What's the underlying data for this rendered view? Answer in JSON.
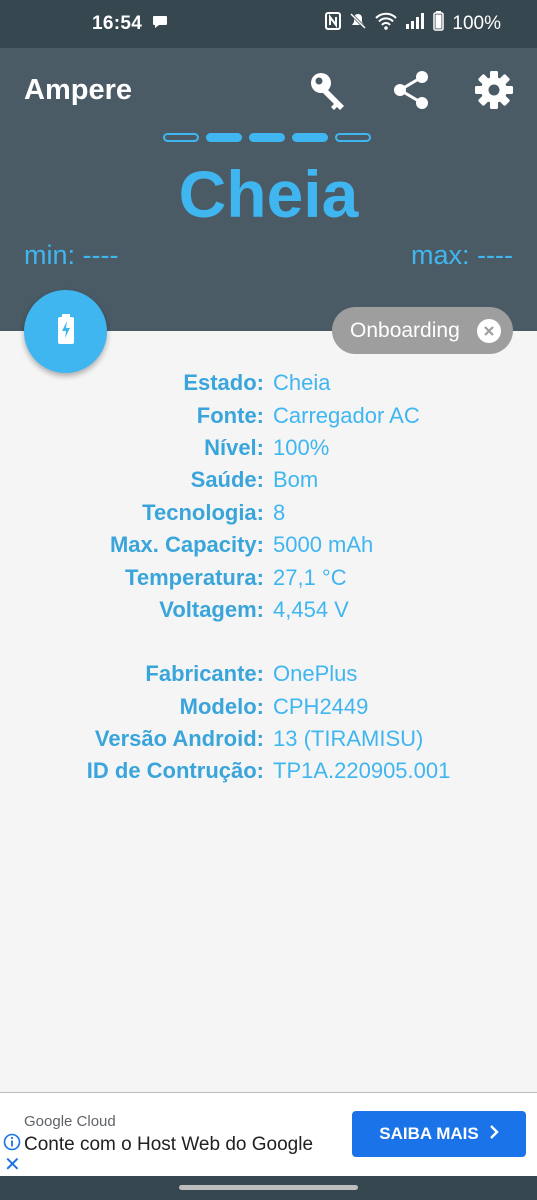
{
  "status_bar": {
    "time": "16:54",
    "battery_pct": "100%"
  },
  "header": {
    "app_title": "Ampere",
    "state": "Cheia",
    "min_text": "min: ----",
    "max_text": "max: ----",
    "progress_dots": [
      false,
      true,
      true,
      true,
      false
    ],
    "icons": [
      "key-icon",
      "share-icon",
      "settings-icon"
    ]
  },
  "chip": {
    "label": "Onboarding"
  },
  "info": {
    "battery": [
      {
        "label": "Estado:",
        "value": "Cheia"
      },
      {
        "label": "Fonte:",
        "value": "Carregador AC"
      },
      {
        "label": "Nível:",
        "value": "100%"
      },
      {
        "label": "Saúde:",
        "value": "Bom"
      },
      {
        "label": "Tecnologia:",
        "value": "8"
      },
      {
        "label": "Max. Capacity:",
        "value": "5000 mAh"
      },
      {
        "label": "Temperatura:",
        "value": "27,1 °C"
      },
      {
        "label": "Voltagem:",
        "value": "4,454 V"
      }
    ],
    "device": [
      {
        "label": "Fabricante:",
        "value": "OnePlus"
      },
      {
        "label": "Modelo:",
        "value": "CPH2449"
      },
      {
        "label": "Versão Android:",
        "value": "13 (TIRAMISU)"
      },
      {
        "label": "ID de Contrução:",
        "value": "TP1A.220905.001"
      }
    ]
  },
  "ad": {
    "sponsor": "Google Cloud",
    "headline": "Conte com o Host Web do Google",
    "cta": "SAIBA MAIS"
  },
  "colors": {
    "accent": "#40b6f0",
    "header_bg": "#4a5b66",
    "status_bg": "#37474f",
    "ad_button": "#1a73e8"
  }
}
